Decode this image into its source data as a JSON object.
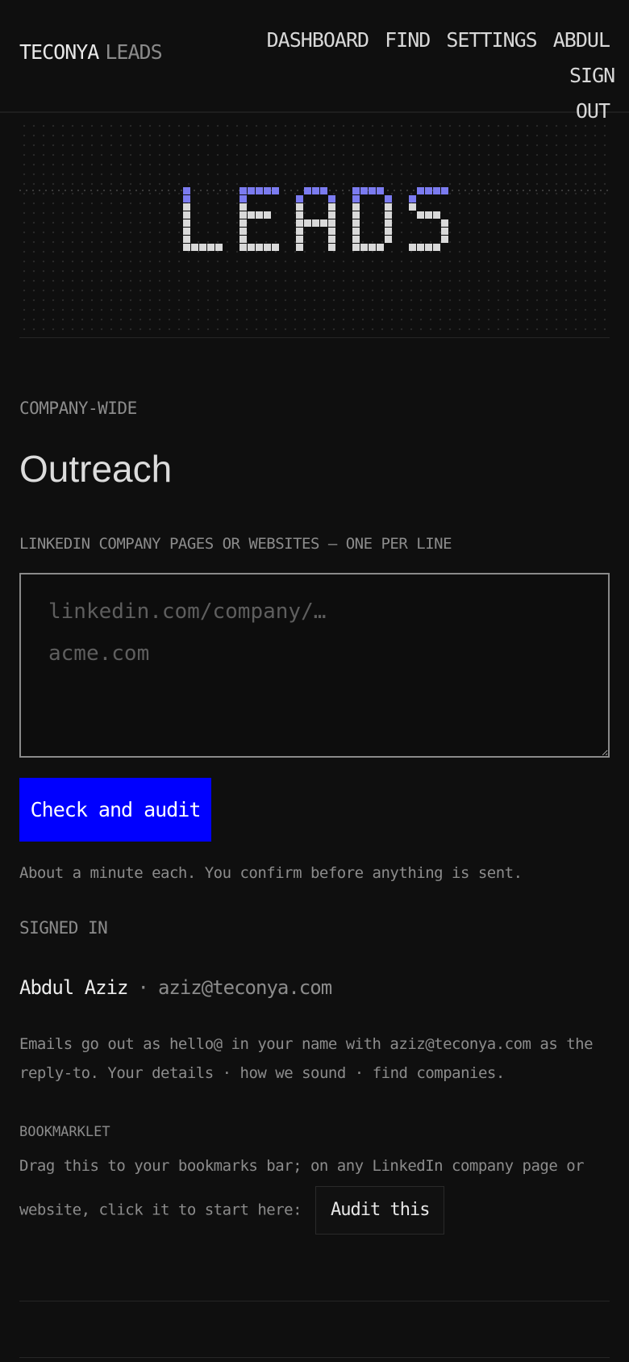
{
  "header": {
    "brand_primary": "TECONYA",
    "brand_secondary": "LEADS",
    "nav": [
      "DASHBOARD",
      "FIND",
      "SETTINGS",
      "ABDUL",
      "SIGN OUT"
    ]
  },
  "hero": {
    "wordmark": "LEADS"
  },
  "section": {
    "eyebrow": "COMPANY-WIDE",
    "title": "Outreach"
  },
  "form": {
    "field_label": "LINKEDIN COMPANY PAGES OR WEBSITES — ONE PER LINE",
    "placeholder": "linkedin.com/company/…\nacme.com",
    "value": "",
    "submit_label": "Check and audit",
    "hint": "About a minute each. You confirm before anything is sent."
  },
  "account": {
    "label": "SIGNED IN",
    "name": "Abdul Aziz",
    "separator": "·",
    "email": "aziz@teconya.com",
    "note_prefix": "Emails go out as hello@ in your name with aziz@teconya.com as the reply-to.",
    "links": [
      "Your details",
      "how we sound",
      "find companies."
    ]
  },
  "bookmarklet": {
    "label": "BOOKMARKLET",
    "text": "Drag this to your bookmarks bar; on any LinkedIn company page or website, click it to start here:",
    "button_label": "Audit this"
  },
  "colors": {
    "background": "#0f0f0f",
    "accent_button": "#0000ff",
    "wordmark_highlight": "#7b7bf0",
    "wordmark_body": "#d9d9d9"
  }
}
